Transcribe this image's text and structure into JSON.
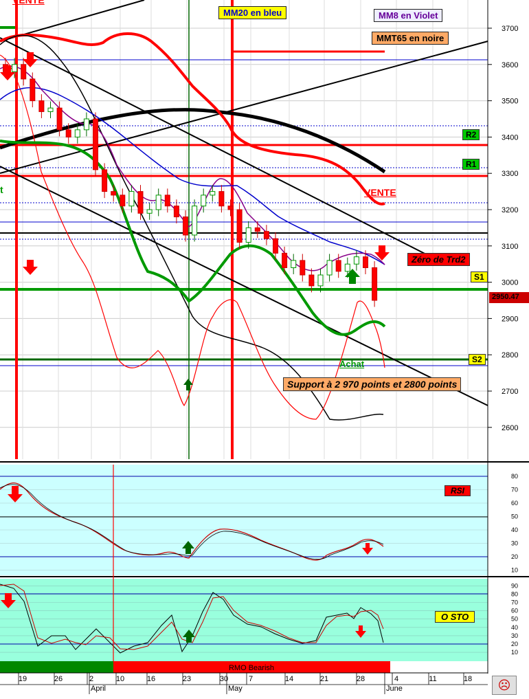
{
  "chart_data": [
    {
      "type": "candlestick",
      "title": "",
      "ylim": [
        2570,
        3760
      ],
      "y_ticks": [
        2600,
        2700,
        2800,
        2900,
        3000,
        3100,
        3200,
        3300,
        3400,
        3500,
        3600,
        3700
      ],
      "last_price_label": "2950.47",
      "legend": {
        "mm20": "MM20 en bleu",
        "mm8": "MM8 en Violet",
        "mmt65": "MMT65 en noire"
      },
      "levels": {
        "r2": "R2",
        "r1": "R1",
        "s1": "S1",
        "s2": "S2"
      },
      "annotations": {
        "vente_top": "VENTE",
        "vente_right": "VENTE",
        "zero_trd2": "Zéro de Trd2",
        "achat": "Achat",
        "support": "Support à 2 970 points et 2800 points",
        "left_partial": "t"
      },
      "candles_close_approx": [
        3580,
        3600,
        3560,
        3500,
        3470,
        3480,
        3420,
        3400,
        3420,
        3450,
        3310,
        3250,
        3240,
        3210,
        3250,
        3190,
        3200,
        3240,
        3210,
        3180,
        3130,
        3210,
        3240,
        3250,
        3210,
        3200,
        3110,
        3150,
        3140,
        3120,
        3080,
        3040,
        3060,
        3020,
        2990,
        3020,
        3060,
        3030,
        3050,
        3070,
        3040,
        2950
      ]
    },
    {
      "type": "line",
      "label": "RSI",
      "y_ticks": [
        10,
        20,
        30,
        40,
        50,
        60,
        70,
        80
      ],
      "levels": [
        80,
        50,
        20
      ]
    },
    {
      "type": "line",
      "label": "O STO",
      "y_ticks": [
        10,
        20,
        30,
        40,
        50,
        60,
        70,
        80,
        90
      ],
      "levels": [
        80,
        20
      ]
    }
  ],
  "rmo_bar_label": "RMO Bearish",
  "x_axis": {
    "day_labels": [
      "19",
      "26",
      "2",
      "10",
      "16",
      "23",
      "30",
      "7",
      "14",
      "21",
      "28",
      "4",
      "11",
      "18"
    ],
    "month_labels": [
      "April",
      "May",
      "June"
    ]
  },
  "colors": {
    "panel_bg": "#ccffff",
    "sto_bg": "#99ffdd",
    "red": "#ff0000",
    "green": "#009900",
    "blue": "#0000cc",
    "black": "#000000"
  },
  "icons": {
    "smiley": "sad-face-icon"
  }
}
